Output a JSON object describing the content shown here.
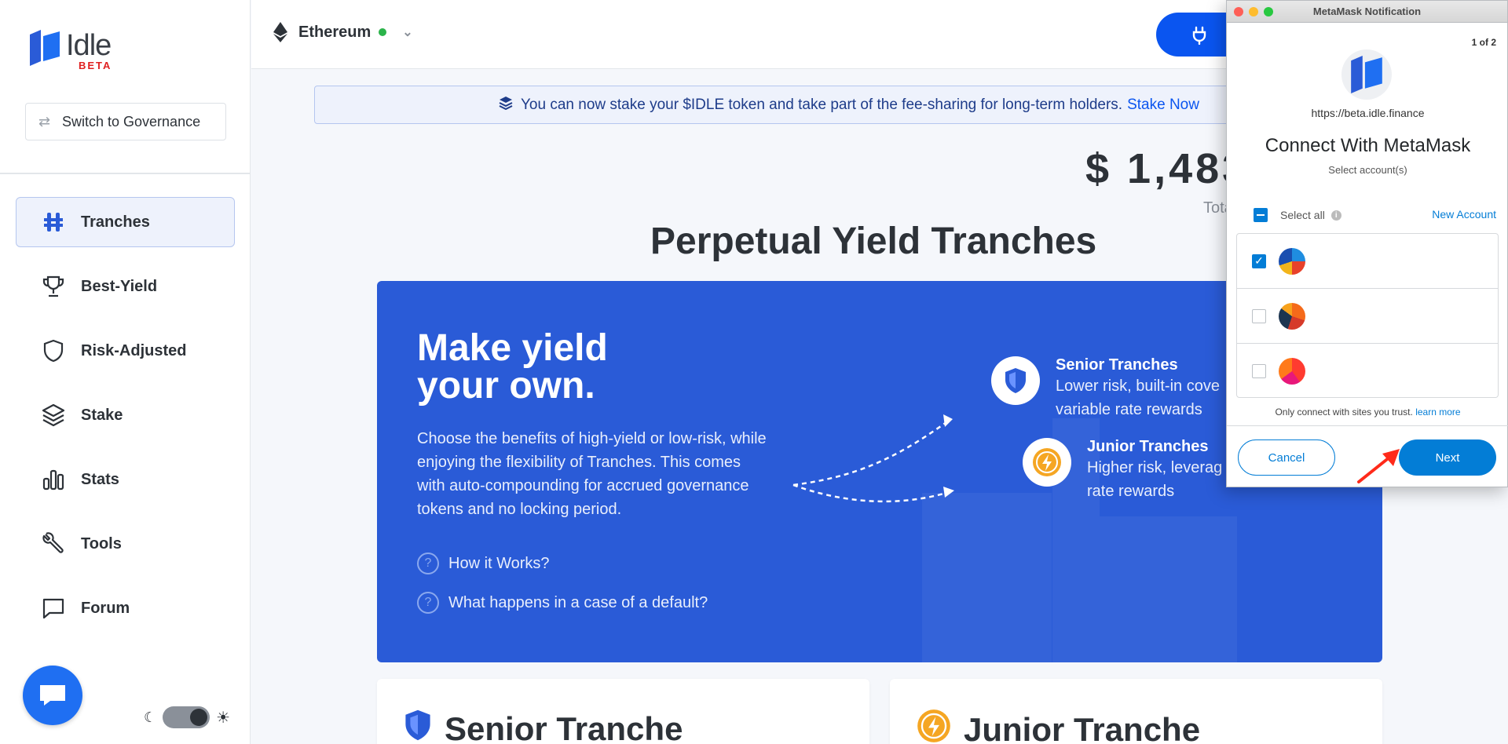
{
  "sidebar": {
    "logo_text": "Idle",
    "logo_badge": "BETA",
    "switch_label": "Switch to Governance",
    "items": [
      {
        "label": "Tranches",
        "icon": "tranches-icon",
        "active": true
      },
      {
        "label": "Best-Yield",
        "icon": "trophy-icon",
        "active": false
      },
      {
        "label": "Risk-Adjusted",
        "icon": "shield-icon",
        "active": false
      },
      {
        "label": "Stake",
        "icon": "layers-icon",
        "active": false
      },
      {
        "label": "Stats",
        "icon": "bar-chart-icon",
        "active": false
      },
      {
        "label": "Tools",
        "icon": "wrench-icon",
        "active": false
      },
      {
        "label": "Forum",
        "icon": "chat-bubble-icon",
        "active": false
      }
    ]
  },
  "topbar": {
    "network": "Ethereum",
    "network_status_color": "#2bb34a"
  },
  "banner": {
    "text": "You can now stake your $IDLE token and take part of the fee-sharing for long-term holders.",
    "link": "Stake Now"
  },
  "tvl": {
    "value": "$  1,483",
    "label": "Total"
  },
  "main": {
    "title": "Perpetual Yield Tranches",
    "hero": {
      "title_line1": "Make yield",
      "title_line2": "your own.",
      "description": "Choose the benefits of high-yield or low-risk, while enjoying the flexibility of Tranches. This comes with auto-compounding for accrued governance tokens and no locking period.",
      "q1": "How it Works?",
      "q2": "What happens in a case of a default?",
      "senior_name": "Senior Tranches",
      "senior_desc1": "Lower risk, built-in cove",
      "senior_desc2": "variable rate rewards",
      "junior_name": "Junior Tranches",
      "junior_desc1": "Higher risk, leverag",
      "junior_desc2": "rate rewards"
    },
    "senior_card_title": "Senior Tranche",
    "junior_card_title": "Junior Tranche"
  },
  "metamask": {
    "window_title": "MetaMask Notification",
    "page_indicator": "1 of 2",
    "site_url": "https://beta.idle.finance",
    "title": "Connect With MetaMask",
    "subtitle": "Select account(s)",
    "select_all": "Select all",
    "new_account": "New Account",
    "accounts": [
      {
        "checked": true
      },
      {
        "checked": false
      },
      {
        "checked": false
      }
    ],
    "trust_text": "Only connect with sites you trust.",
    "learn_more": "learn more",
    "cancel": "Cancel",
    "next": "Next"
  },
  "colors": {
    "accent": "#0a55f0",
    "hero_bg": "#2a5bd7",
    "metamask_blue": "#037dd6",
    "annotation_arrow": "#ff2a1a"
  }
}
